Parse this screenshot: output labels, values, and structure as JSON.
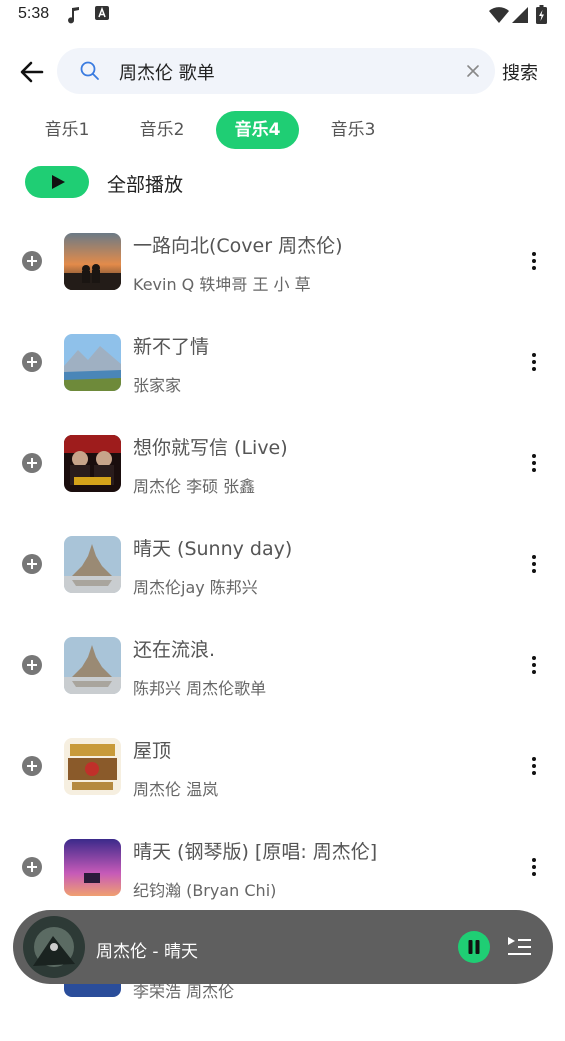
{
  "status": {
    "time": "5:38"
  },
  "search": {
    "query": "周杰伦 歌单",
    "button_label": "搜索"
  },
  "tabs": [
    {
      "label": "音乐1",
      "active": false
    },
    {
      "label": "音乐2",
      "active": false
    },
    {
      "label": "音乐4",
      "active": true
    },
    {
      "label": "音乐3",
      "active": false
    }
  ],
  "play_all": {
    "label": "全部播放"
  },
  "songs": [
    {
      "title": "一路向北(Cover 周杰伦)",
      "artist": "Kevin Q 轶坤哥 王 小 草"
    },
    {
      "title": "新不了情",
      "artist": "张家家"
    },
    {
      "title": "想你就写信 (Live)",
      "artist": "周杰伦 李硕 张鑫"
    },
    {
      "title": "晴天 (Sunny day)",
      "artist": "周杰伦jay 陈邦兴"
    },
    {
      "title": "还在流浪.",
      "artist": "陈邦兴 周杰伦歌单"
    },
    {
      "title": "屋顶",
      "artist": "周杰伦 温岚"
    },
    {
      "title": "晴天 (钢琴版) [原唱: 周杰伦]",
      "artist": "纪钧瀚 (Bryan Chi)"
    },
    {
      "title": "",
      "artist": "李荣浩 周杰伦"
    }
  ],
  "player": {
    "now_playing": "周杰伦 - 晴天"
  },
  "colors": {
    "accent": "#1fce74",
    "player_bg": "#5f5f5f",
    "search_bg": "#f1f4fa"
  }
}
